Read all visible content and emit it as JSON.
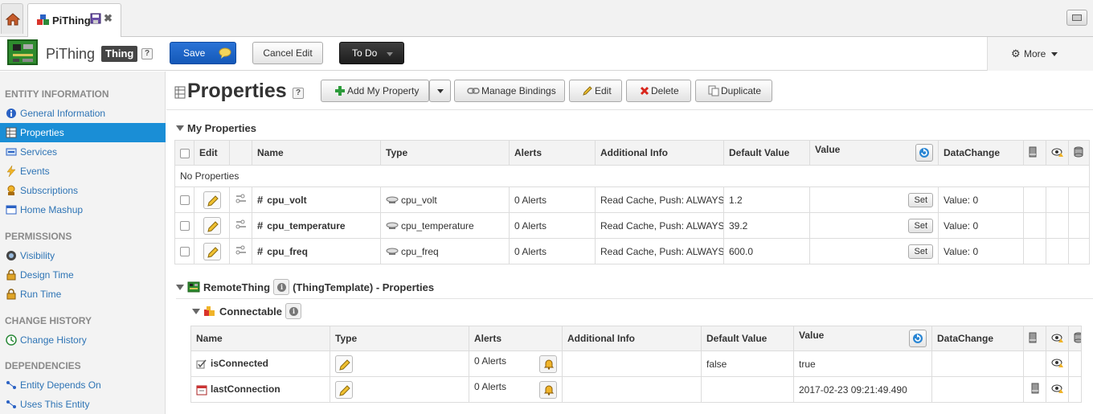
{
  "tabs": {
    "home_icon": "home-icon",
    "active_tab_label": "PiThing"
  },
  "header": {
    "entity_name": "PiThing",
    "entity_type": "Thing",
    "help": "?",
    "save_label": "Save",
    "cancel_label": "Cancel Edit",
    "todo_label": "To Do",
    "more_label": "More"
  },
  "sidebar": {
    "sections": [
      {
        "heading": "ENTITY INFORMATION",
        "items": [
          "General Information",
          "Properties",
          "Services",
          "Events",
          "Subscriptions",
          "Home Mashup"
        ]
      },
      {
        "heading": "PERMISSIONS",
        "items": [
          "Visibility",
          "Design Time",
          "Run Time"
        ]
      },
      {
        "heading": "CHANGE HISTORY",
        "items": [
          "Change History"
        ]
      },
      {
        "heading": "DEPENDENCIES",
        "items": [
          "Entity Depends On",
          "Uses This Entity"
        ]
      }
    ],
    "active_item": "Properties"
  },
  "main": {
    "title": "Properties",
    "help": "?",
    "actions": {
      "add": "Add My Property",
      "manage": "Manage Bindings",
      "edit": "Edit",
      "delete": "Delete",
      "duplicate": "Duplicate"
    },
    "my_properties": {
      "heading": "My Properties",
      "columns": [
        "Edit",
        "Name",
        "Type",
        "Alerts",
        "Additional Info",
        "Default Value",
        "Value",
        "DataChange"
      ],
      "no_props": "No Properties",
      "rows": [
        {
          "name": "cpu_volt",
          "type": "cpu_volt",
          "alerts": "0 Alerts",
          "info": "Read Cache, Push: ALWAYS",
          "default": "1.2",
          "set": "Set",
          "datachange": "Value: 0"
        },
        {
          "name": "cpu_temperature",
          "type": "cpu_temperature",
          "alerts": "0 Alerts",
          "info": "Read Cache, Push: ALWAYS",
          "default": "39.2",
          "set": "Set",
          "datachange": "Value: 0"
        },
        {
          "name": "cpu_freq",
          "type": "cpu_freq",
          "alerts": "0 Alerts",
          "info": "Read Cache, Push: ALWAYS",
          "default": "600.0",
          "set": "Set",
          "datachange": "Value: 0"
        }
      ]
    },
    "template": {
      "name": "RemoteThing",
      "suffix": "(ThingTemplate) - Properties",
      "shape": "Connectable",
      "columns": [
        "Name",
        "Type",
        "Alerts",
        "Additional Info",
        "Default Value",
        "Value",
        "DataChange"
      ],
      "rows": [
        {
          "name": "isConnected",
          "alerts": "0 Alerts",
          "info": "",
          "default": "false",
          "value": "true",
          "datachange": ""
        },
        {
          "name": "lastConnection",
          "alerts": "0 Alerts",
          "info": "",
          "default": "",
          "value": "2017-02-23 09:21:49.490",
          "datachange": ""
        }
      ]
    }
  },
  "colors": {
    "primary": "#1a8ed6",
    "save": "#1f66c9",
    "link": "#2e74b5"
  }
}
